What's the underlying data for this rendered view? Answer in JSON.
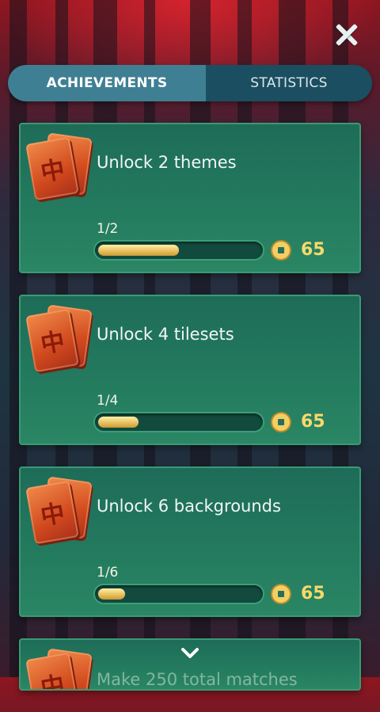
{
  "tabs": [
    {
      "label": "ACHIEVEMENTS",
      "active": true
    },
    {
      "label": "STATISTICS",
      "active": false
    }
  ],
  "achievements": [
    {
      "title": "Unlock 2 themes",
      "progress_text": "1/2",
      "progress_fraction": 0.5,
      "reward": "65",
      "tile_glyph": "中"
    },
    {
      "title": "Unlock 4 tilesets",
      "progress_text": "1/4",
      "progress_fraction": 0.25,
      "reward": "65",
      "tile_glyph": "中"
    },
    {
      "title": "Unlock 6 backgrounds",
      "progress_text": "1/6",
      "progress_fraction": 0.1667,
      "reward": "65",
      "tile_glyph": "中"
    },
    {
      "title": "Make 250 total matches",
      "tile_glyph": "中"
    }
  ],
  "icons": {
    "close": "close-icon",
    "coin": "coin-icon",
    "scroll": "chevron-down-icon",
    "tile": "mahjong-tile-icon"
  },
  "colors": {
    "card": "#237a5e",
    "tab_active": "#3f7f93",
    "tab_bar": "#1b4e60",
    "progress_fill": "#e9c160",
    "reward_text": "#f7d96a"
  }
}
